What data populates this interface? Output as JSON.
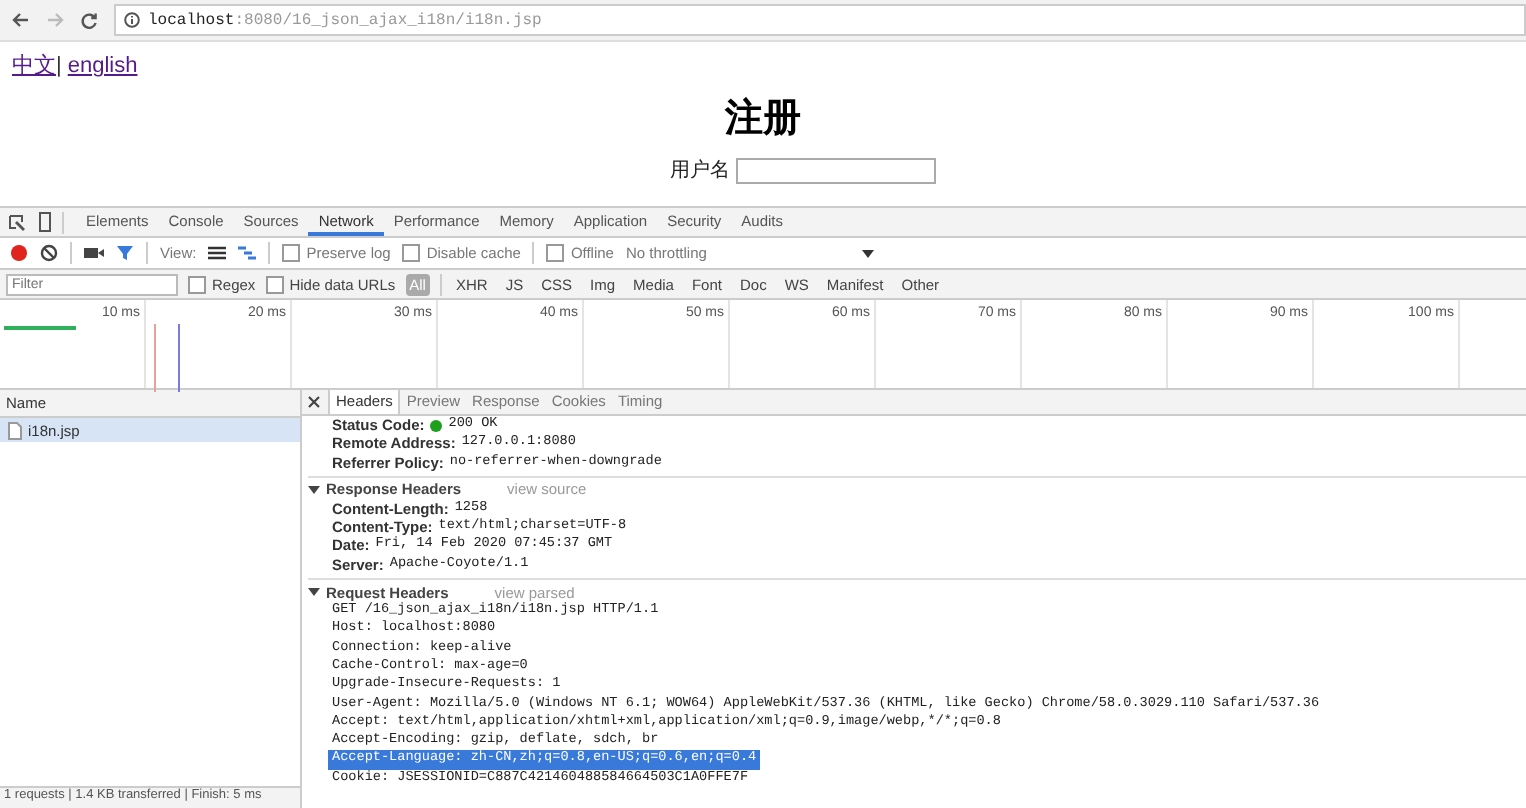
{
  "browser": {
    "address": "**localhost**:8080/16_json_ajax_i18n/i18n.jsp"
  },
  "page": {
    "links": [
      {
        "label": "中文"
      },
      {
        "label": "english"
      }
    ],
    "separator": "|",
    "title": "注册",
    "fields": [
      {
        "label": "用户名"
      }
    ]
  },
  "devtools": {
    "tabs": [
      {
        "label": "Elements",
        "selected": false
      },
      {
        "label": "Console",
        "selected": false
      },
      {
        "label": "Sources",
        "selected": false
      },
      {
        "label": "Network",
        "selected": true
      },
      {
        "label": "Performance",
        "selected": false
      },
      {
        "label": "Memory",
        "selected": false
      },
      {
        "label": "Application",
        "selected": false
      },
      {
        "label": "Security",
        "selected": false
      },
      {
        "label": "Audits",
        "selected": false
      }
    ],
    "toolbar": {
      "recording": true,
      "view_label": "View:",
      "options": [
        {
          "label": "Preserve log",
          "checked": false
        },
        {
          "label": "Disable cache",
          "checked": false
        },
        {
          "label": "Offline",
          "checked": false
        }
      ],
      "throttling": "No throttling"
    },
    "filter": {
      "placeholder": "Filter",
      "options": [
        {
          "label": "Regex",
          "checked": false
        },
        {
          "label": "Hide data URLs",
          "checked": false
        }
      ],
      "types": [
        {
          "label": "All",
          "selected": true
        },
        {
          "label": "XHR",
          "selected": false
        },
        {
          "label": "JS",
          "selected": false
        },
        {
          "label": "CSS",
          "selected": false
        },
        {
          "label": "Img",
          "selected": false
        },
        {
          "label": "Media",
          "selected": false
        },
        {
          "label": "Font",
          "selected": false
        },
        {
          "label": "Doc",
          "selected": false
        },
        {
          "label": "WS",
          "selected": false
        },
        {
          "label": "Manifest",
          "selected": false
        },
        {
          "label": "Other",
          "selected": false
        }
      ]
    },
    "timeline_ticks": [
      "10 ms",
      "20 ms",
      "30 ms",
      "40 ms",
      "50 ms",
      "60 ms",
      "70 ms",
      "80 ms",
      "90 ms",
      "100 ms"
    ],
    "requests": {
      "column": "Name",
      "rows": [
        {
          "name": "i18n.jsp",
          "selected": true
        }
      ]
    },
    "detail_tabs": [
      {
        "label": "Headers",
        "selected": true
      },
      {
        "label": "Preview",
        "selected": false
      },
      {
        "label": "Response",
        "selected": false
      },
      {
        "label": "Cookies",
        "selected": false
      },
      {
        "label": "Timing",
        "selected": false
      }
    ],
    "general": [
      {
        "key": "Status Code:",
        "value": "200 OK",
        "kind": "status"
      },
      {
        "key": "Remote Address:",
        "value": "127.0.0.1:8080",
        "kind": "plain"
      },
      {
        "key": "Referrer Policy:",
        "value": "no-referrer-when-downgrade",
        "kind": "plain"
      }
    ],
    "sections": [
      {
        "title": "Response Headers",
        "link": "view source",
        "expanded": true,
        "kind": "parsed",
        "headers": [
          {
            "key": "Content-Length:",
            "value": "1258"
          },
          {
            "key": "Content-Type:",
            "value": "text/html;charset=UTF-8"
          },
          {
            "key": "Date:",
            "value": "Fri, 14 Feb 2020 07:45:37 GMT"
          },
          {
            "key": "Server:",
            "value": "Apache-Coyote/1.1"
          }
        ]
      },
      {
        "title": "Request Headers",
        "link": "view parsed",
        "expanded": true,
        "kind": "raw",
        "lines": [
          {
            "text": "GET /16_json_ajax_i18n/i18n.jsp HTTP/1.1",
            "selected": false
          },
          {
            "text": "Host: localhost:8080",
            "selected": false
          },
          {
            "text": "Connection: keep-alive",
            "selected": false
          },
          {
            "text": "Cache-Control: max-age=0",
            "selected": false
          },
          {
            "text": "Upgrade-Insecure-Requests: 1",
            "selected": false
          },
          {
            "text": "User-Agent: Mozilla/5.0 (Windows NT 6.1; WOW64) AppleWebKit/537.36 (KHTML, like Gecko) Chrome/58.0.3029.110 Safari/537.36",
            "selected": false
          },
          {
            "text": "Accept: text/html,application/xhtml+xml,application/xml;q=0.9,image/webp,*/*;q=0.8",
            "selected": false
          },
          {
            "text": "Accept-Encoding: gzip, deflate, sdch, br",
            "selected": false
          },
          {
            "text": "Accept-Language: zh-CN,zh;q=0.8,en-US;q=0.6,en;q=0.4",
            "selected": true
          },
          {
            "text": "Cookie: JSESSIONID=C887C421460488584664503C1A0FFE7F",
            "selected": false
          }
        ]
      }
    ],
    "status_bar": "1 requests | 1.4 KB transferred | Finish: 5 ms"
  }
}
